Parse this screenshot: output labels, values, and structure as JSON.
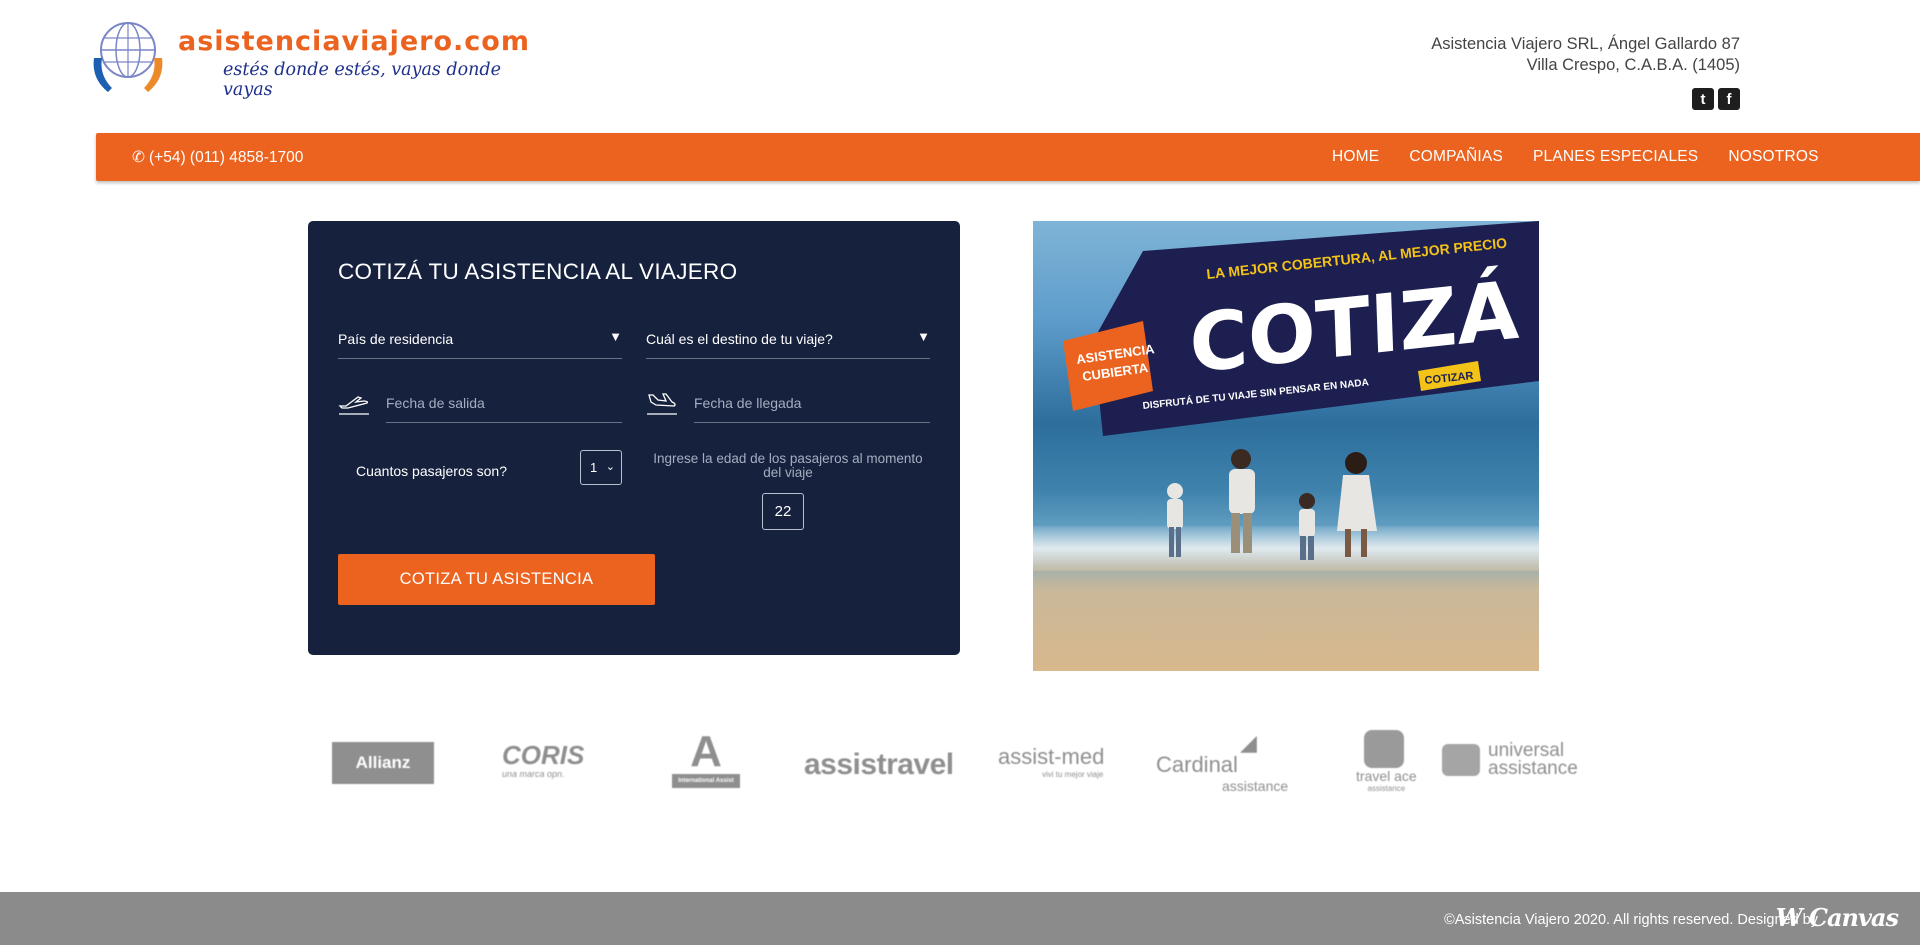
{
  "header": {
    "logo_title": "asistenciaviajero.com",
    "logo_tagline": "estés donde estés, vayas donde vayas",
    "address_line1": "Asistencia Viajero SRL, Ángel Gallardo 87",
    "address_line2": "Villa Crespo, C.A.B.A. (1405)",
    "social": [
      {
        "icon": "twitter-icon",
        "glyph": "t"
      },
      {
        "icon": "facebook-icon",
        "glyph": "f"
      }
    ]
  },
  "nav": {
    "phone": "(+54) (011) 4858-1700",
    "links": [
      "HOME",
      "COMPAÑIAS",
      "PLANES ESPECIALES",
      "NOSOTROS"
    ]
  },
  "form": {
    "title": "COTIZÁ TU ASISTENCIA AL VIAJERO",
    "residence_placeholder": "País de residencia",
    "destination_placeholder": "Cuál es el destino de tu viaje?",
    "departure_placeholder": "Fecha de salida",
    "arrival_placeholder": "Fecha de llegada",
    "passengers_label": "Cuantos pasajeros son?",
    "passengers_value": "1",
    "age_label": "Ingrese la edad de los pasajeros al momento del viaje",
    "age_value": "22",
    "submit_label": "COTIZA TU ASISTENCIA"
  },
  "promo": {
    "headline": "LA MEJOR COBERTURA, AL MEJOR PRECIO",
    "big_word": "COTIZÁ",
    "badge_line1": "ASISTENCIA",
    "badge_line2": "CUBIERTA",
    "subline": "DISFRUTÁ DE TU VIAJE SIN PENSAR EN NADA",
    "button": "COTIZAR"
  },
  "partners": [
    {
      "name": "Allianz",
      "sub": ""
    },
    {
      "name": "CORIS",
      "sub": "una marca opn."
    },
    {
      "name": "A",
      "sub": "International Assist"
    },
    {
      "name": "assistravel",
      "sub": ""
    },
    {
      "name": "assist-med",
      "sub": "vivi tu mejor viaje"
    },
    {
      "name": "Cardinal",
      "sub": "assistance"
    },
    {
      "name": "travel ace",
      "sub": "assistance"
    },
    {
      "name": "universal",
      "sub": "assistance"
    }
  ],
  "footer": {
    "text": "©Asistencia Viajero 2020. All rights reserved. Designed by",
    "designer": "W Canvas"
  },
  "colors": {
    "brand_orange": "#ec6320",
    "panel_navy": "#16213d",
    "footer_gray": "#8b8b8b"
  }
}
